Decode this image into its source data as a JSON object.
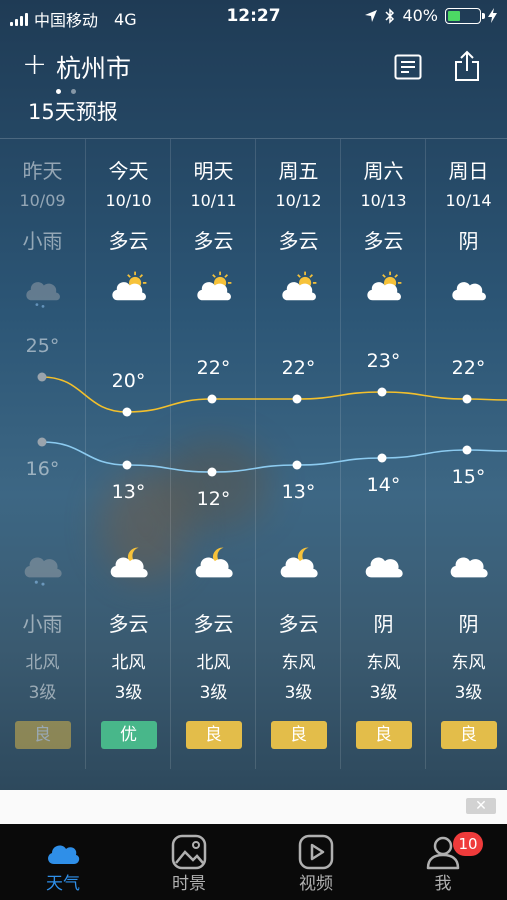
{
  "status_bar": {
    "carrier": "中国移动",
    "network": "4G",
    "time": "12:27",
    "battery": "40%",
    "battery_level": 0.4
  },
  "header": {
    "city": "杭州市",
    "forecast_title": "15天预报"
  },
  "days": [
    {
      "day": "昨天",
      "date": "10/09",
      "day_cond": "小雨",
      "day_icon": "rain-cloud-icon",
      "high": "25°",
      "low": "16°",
      "high_value": 25,
      "low_value": 16,
      "night_icon": "rain-cloud-icon",
      "night_cond": "小雨",
      "wind": "北风",
      "wind_level": "3级",
      "aqi": "良",
      "aqi_color": "#e3bd4a",
      "past": true
    },
    {
      "day": "今天",
      "date": "10/10",
      "day_cond": "多云",
      "day_icon": "partly-cloudy-day-icon",
      "high": "20°",
      "low": "13°",
      "high_value": 20,
      "low_value": 13,
      "night_icon": "partly-cloudy-night-icon",
      "night_cond": "多云",
      "wind": "北风",
      "wind_level": "3级",
      "aqi": "优",
      "aqi_color": "#48b78a",
      "past": false
    },
    {
      "day": "明天",
      "date": "10/11",
      "day_cond": "多云",
      "day_icon": "partly-cloudy-day-icon",
      "high": "22°",
      "low": "12°",
      "high_value": 22,
      "low_value": 12,
      "night_icon": "partly-cloudy-night-icon",
      "night_cond": "多云",
      "wind": "北风",
      "wind_level": "3级",
      "aqi": "良",
      "aqi_color": "#e3bd4a",
      "past": false
    },
    {
      "day": "周五",
      "date": "10/12",
      "day_cond": "多云",
      "day_icon": "partly-cloudy-day-icon",
      "high": "22°",
      "low": "13°",
      "high_value": 22,
      "low_value": 13,
      "night_icon": "partly-cloudy-night-icon",
      "night_cond": "多云",
      "wind": "东风",
      "wind_level": "3级",
      "aqi": "良",
      "aqi_color": "#e3bd4a",
      "past": false
    },
    {
      "day": "周六",
      "date": "10/13",
      "day_cond": "多云",
      "day_icon": "partly-cloudy-day-icon",
      "high": "23°",
      "low": "14°",
      "high_value": 23,
      "low_value": 14,
      "night_icon": "cloud-icon",
      "night_cond": "阴",
      "wind": "东风",
      "wind_level": "3级",
      "aqi": "良",
      "aqi_color": "#e3bd4a",
      "past": false
    },
    {
      "day": "周日",
      "date": "10/14",
      "day_cond": "阴",
      "day_icon": "cloud-icon",
      "high": "22°",
      "low": "15°",
      "high_value": 22,
      "low_value": 15,
      "night_icon": "cloud-icon",
      "night_cond": "阴",
      "wind": "东风",
      "wind_level": "3级",
      "aqi": "良",
      "aqi_color": "#e3bd4a",
      "past": false
    }
  ],
  "colors": {
    "high_line": "#f3c02c",
    "low_line": "#8ccbf0",
    "active_tab": "#2f8fe8"
  },
  "ad": {
    "close_label": "✕"
  },
  "tabbar": {
    "tabs": [
      {
        "label": "天气",
        "icon": "cloud-tab-icon",
        "active": true
      },
      {
        "label": "时景",
        "icon": "scenery-tab-icon",
        "active": false
      },
      {
        "label": "视频",
        "icon": "video-tab-icon",
        "active": false
      },
      {
        "label": "我",
        "icon": "profile-tab-icon",
        "active": false
      }
    ],
    "profile_badge": "10"
  }
}
